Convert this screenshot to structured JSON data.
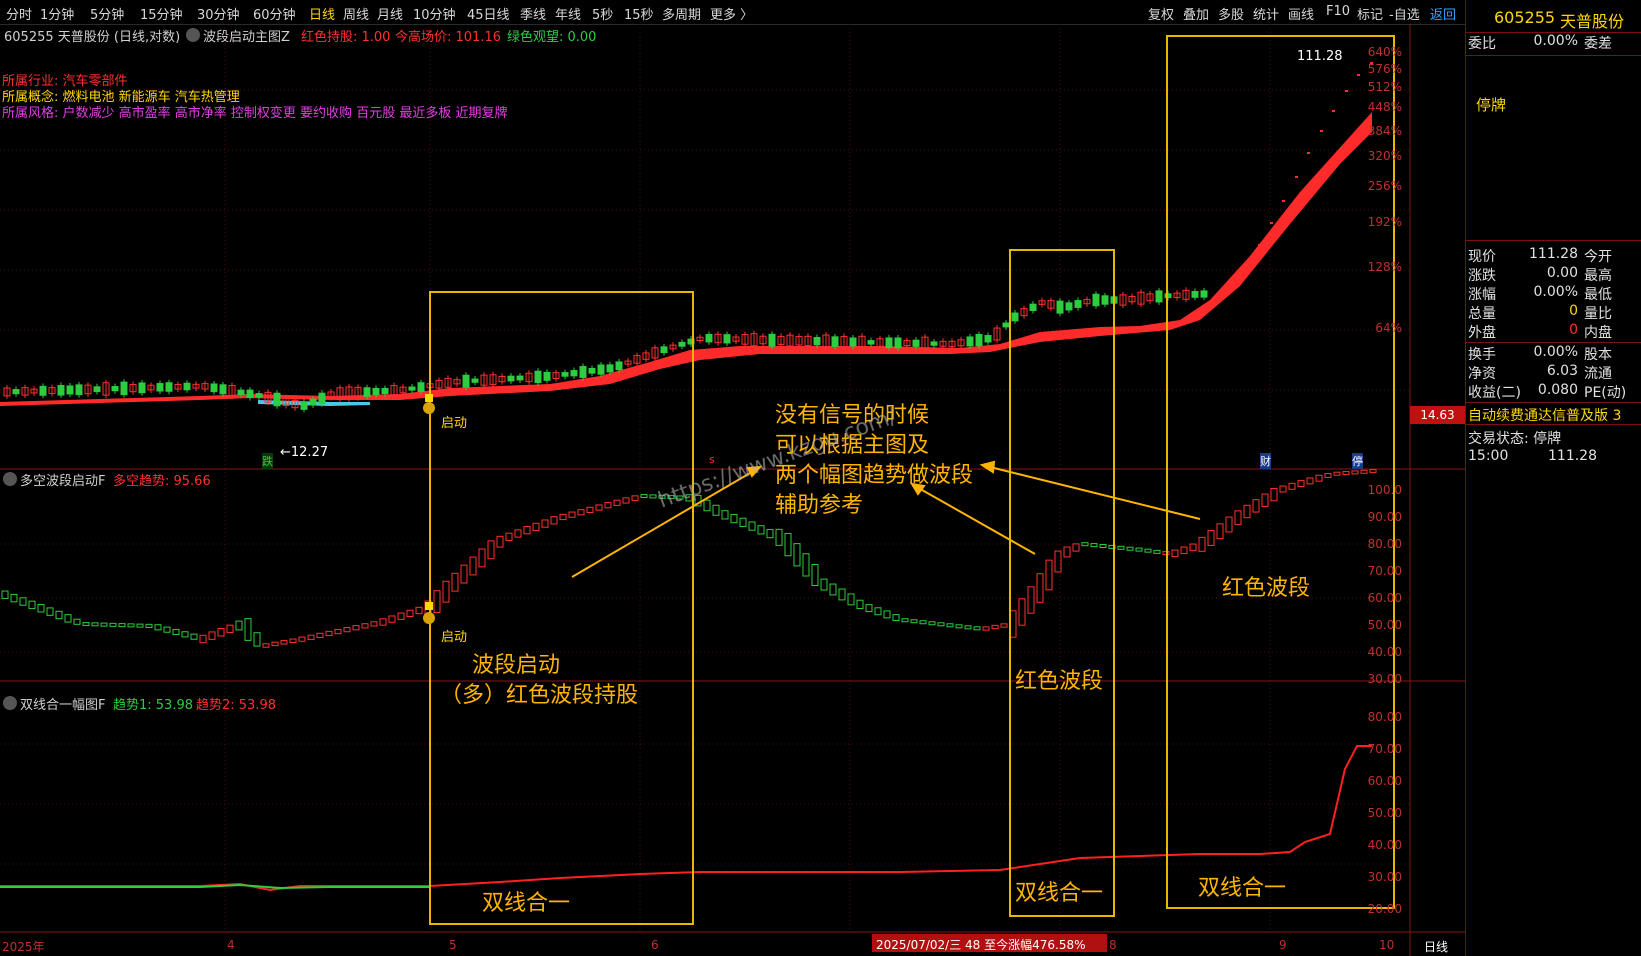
{
  "toolbar": {
    "periods": [
      "分时",
      "1分钟",
      "5分钟",
      "15分钟",
      "30分钟",
      "60分钟",
      "日线",
      "周线",
      "月线",
      "10分钟",
      "45日线",
      "季线",
      "年线",
      "5秒",
      "15秒",
      "多周期",
      "更多 〉"
    ],
    "active_period": "日线",
    "right_tools": [
      "复权",
      "叠加",
      "多股",
      "统计",
      "画线",
      "F10",
      "标记",
      "-自选",
      "返回"
    ]
  },
  "main_chart": {
    "header_code": "605255 天普股份 (日线,对数)",
    "indicator_name": "波段启动主图Z",
    "red_hold": "红色持股: 1.00",
    "today_high": "今高场价: 101.16",
    "green_watch": "绿色观望: 0.00",
    "industry_label": "所属行业:",
    "industry_value": "汽车零部件",
    "concept_label": "所属概念:",
    "concept_value": "燃料电池 新能源车 汽车热管理",
    "style_label": "所属风格:",
    "style_value": "户数减少 高市盈率 高市净率 控制权变更 要约收购 百元股 最近多板 近期复牌",
    "max_price_label": "111.28",
    "min_price_label": "←12.27",
    "fall_marker": "跌",
    "launch_marker": "启动",
    "s_marker": "s",
    "cai_marker": "财",
    "ting_marker": "停",
    "price_tag": "14.63",
    "y_axis": [
      "640%",
      "576%",
      "512%",
      "448%",
      "384%",
      "320%",
      "256%",
      "192%",
      "128%",
      "64%"
    ]
  },
  "panel2": {
    "name": "多空波段启动F",
    "trend": "多空趋势: 95.66",
    "launch_marker": "启动",
    "y_axis": [
      "100.0",
      "90.00",
      "80.00",
      "70.00",
      "60.00",
      "50.00",
      "40.00",
      "30.00"
    ]
  },
  "panel3": {
    "name": "双线合一幅图F",
    "trend1": "趋势1: 53.98",
    "trend2": "趋势2: 53.98",
    "y_axis": [
      "80.00",
      "70.00",
      "60.00",
      "50.00",
      "40.00",
      "30.00",
      "20.00"
    ]
  },
  "annotations": {
    "main_note_lines": [
      "没有信号的时候",
      "可以根据主图及",
      "两个幅图趋势做波段",
      "辅助参考"
    ],
    "watermark": "https://www.kzgu.com/",
    "wave_start_lines": [
      "波段启动",
      "（多）红色波段持股"
    ],
    "red_wave_mid": "红色波段",
    "red_wave_right": "红色波段",
    "two_line_a": "双线合一",
    "two_line_b": "双线合一",
    "two_line_c": "双线合一"
  },
  "x_axis": {
    "labels": [
      "2025年",
      "4",
      "5",
      "6",
      "8",
      "9",
      "10"
    ],
    "date_readout": "2025/07/02/三 48 至今涨幅476.58%",
    "period_tag": "日线"
  },
  "side_panel": {
    "code": "605255",
    "name": "天普股份",
    "wb_label": "委比",
    "wb_value": "0.00%",
    "wc_label": "委差",
    "suspended": "停牌",
    "rows": [
      {
        "l": "现价",
        "v": "111.28",
        "r": "今开"
      },
      {
        "l": "涨跌",
        "v": "0.00",
        "r": "最高"
      },
      {
        "l": "涨幅",
        "v": "0.00%",
        "r": "最低"
      },
      {
        "l": "总量",
        "v": "0",
        "r": "量比"
      },
      {
        "l": "外盘",
        "v": "0",
        "r": "内盘"
      },
      {
        "l": "换手",
        "v": "0.00%",
        "r": "股本"
      },
      {
        "l": "净资",
        "v": "6.03",
        "r": "流通"
      },
      {
        "l": "收益(二)",
        "v": "0.080",
        "r": "PE(动)"
      }
    ],
    "ad_text": "自动续费通达信普及版  3",
    "trade_status": "交易状态: 停牌",
    "time": "15:00",
    "time_price": "111.28"
  },
  "colors": {
    "up": "#ff3030",
    "down": "#2ecc40",
    "box": "#e8b800",
    "note": "#ffb400"
  }
}
